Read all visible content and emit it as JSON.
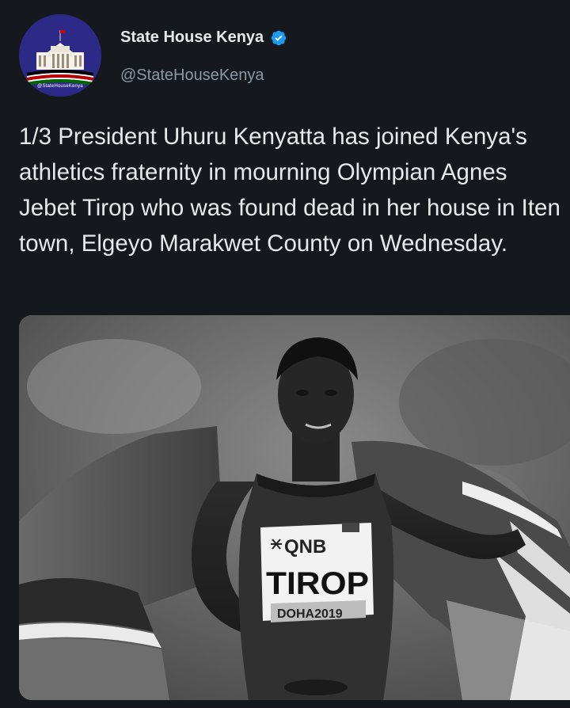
{
  "tweet": {
    "author": {
      "display_name": "State House Kenya",
      "handle": "@StateHouseKenya",
      "verified": true,
      "avatar_caption": "@StateHouseKenya"
    },
    "text": "1/3 President Uhuru Kenyatta has joined Kenya's athletics fraternity in mourning Olympian Agnes Jebet Tirop who was found dead in her house in Iten town, Elgeyo Marakwet County on Wednesday.",
    "media": {
      "bib_sponsor": "QNB",
      "bib_name": "TIROP",
      "bib_event": "DOHA2019"
    }
  },
  "colors": {
    "background": "#15181c",
    "text_primary": "#e7e9ea",
    "text_secondary": "#8b98a5",
    "verified_badge": "#1d9bf0",
    "avatar_bg": "#2c2a86"
  },
  "icons": {
    "verified": "verified-badge-icon"
  }
}
